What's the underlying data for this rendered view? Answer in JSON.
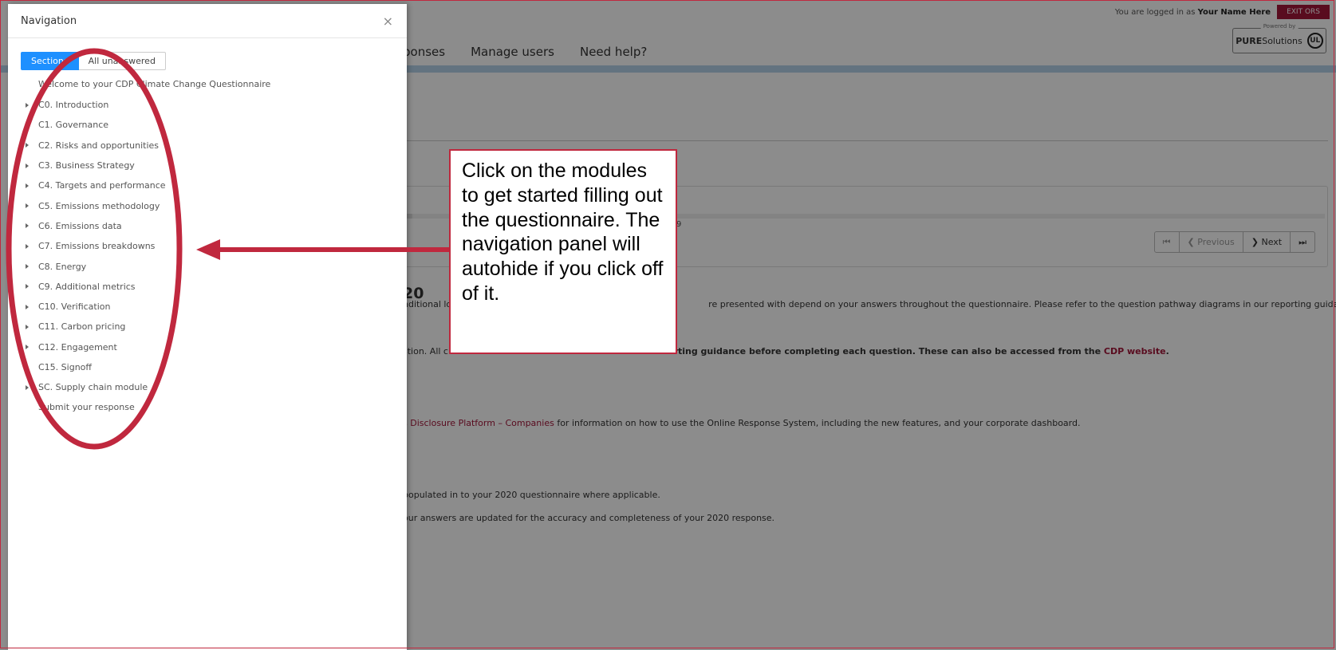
{
  "header": {
    "login_prefix": "You are logged in as",
    "user_name": "Your Name Here",
    "exit_label": "EXIT ORS",
    "powered_by": "Powered by",
    "pure_brand": "PURE",
    "solutions": "Solutions",
    "ul_mark": "UL"
  },
  "menu": [
    "ponses",
    "Manage users",
    "Need help?"
  ],
  "progress": {
    "text": "9",
    "fraction": 0.01
  },
  "pager": {
    "first": "⏮",
    "previous": "❮ Previous",
    "next": "❯ Next",
    "last": "⏭"
  },
  "content": {
    "heading": "20",
    "line1_a": "nditional lo",
    "line1_b": "re presented with depend on your answers throughout the questionnaire. Please refer to the question pathway diagrams in our reporting guidance",
    "line2_a": "stion. All c",
    "line2_b": "orting guidance before completing each question. These can also be accessed from the",
    "line2_link": "CDP website",
    "line2_end": ".",
    "line3_link": "s Disclosure Platform – Companies",
    "line3_rest": "for information on how to use the Online Response System, including the new features, and your corporate dashboard.",
    "line4": "populated in to your 2020  questionnaire where applicable.",
    "line5": "our answers are updated for the accuracy and completeness of your 2020  response."
  },
  "panel": {
    "title": "Navigation",
    "close": "×",
    "tab_sections": "Sections",
    "tab_unanswered": "All unanswered",
    "welcome": "Welcome to your CDP Climate Change Questionnaire",
    "items": [
      "C0. Introduction",
      "C1. Governance",
      "C2. Risks and opportunities",
      "C3. Business Strategy",
      "C4. Targets and performance",
      "C5. Emissions methodology",
      "C6. Emissions data",
      "C7. Emissions breakdowns",
      "C8. Energy",
      "C9. Additional metrics",
      "C10. Verification",
      "C11. Carbon pricing",
      "C12. Engagement",
      "C15. Signoff",
      "SC. Supply chain module"
    ],
    "submit": "Submit your response"
  },
  "callout": {
    "text": "Click on the modules to get started filling out the questionnaire. The navigation panel will autohide if you click off of it."
  },
  "colors": {
    "accent": "#c0283e",
    "brand": "#a3163a",
    "active_tab": "#1e90ff"
  }
}
